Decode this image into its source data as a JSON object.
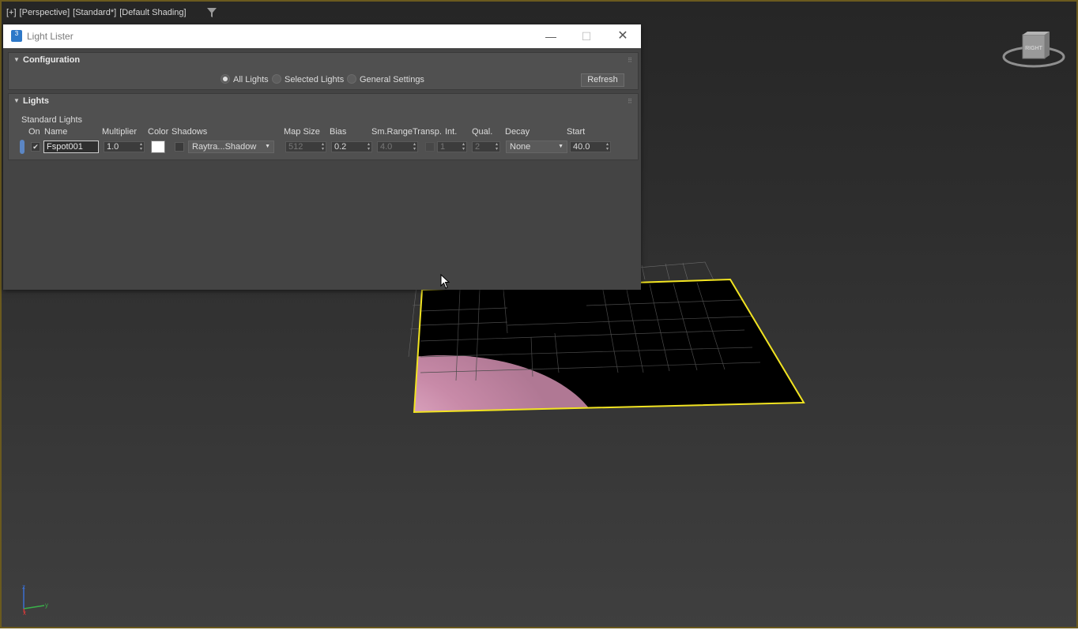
{
  "viewport": {
    "label_parts": [
      "[+]",
      "[Perspective]",
      "[Standard*]",
      "[Default Shading]"
    ],
    "viewcube_face": "RIGHT",
    "axis": {
      "x": "x",
      "y": "y",
      "z": "z"
    },
    "colors": {
      "selection": "#f2e421",
      "light_pool": "#e7a9c9",
      "frame": "#6b5a1e"
    }
  },
  "window": {
    "title": "Light Lister",
    "app_icon_text": "3",
    "controls": {
      "minimize": "—",
      "maximize": "☐",
      "close": "✕"
    }
  },
  "configuration": {
    "title": "Configuration",
    "options": [
      "All Lights",
      "Selected Lights",
      "General Settings"
    ],
    "selected_option": "All Lights",
    "refresh_label": "Refresh"
  },
  "lights": {
    "title": "Lights",
    "group_label": "Standard Lights",
    "headers": {
      "on": "On",
      "name": "Name",
      "multiplier": "Multiplier",
      "color": "Color",
      "shadows": "Shadows",
      "map_size": "Map Size",
      "bias": "Bias",
      "sm_range": "Sm.Range",
      "transp": "Transp.",
      "int": "Int.",
      "qual": "Qual.",
      "decay": "Decay",
      "start": "Start"
    },
    "row": {
      "on": true,
      "name": "Fspot001",
      "multiplier": "1.0",
      "color": "#ffffff",
      "shadows_on": false,
      "shadow_type": "Raytra...Shadow",
      "map_size": "512",
      "bias": "0.2",
      "sm_range": "4.0",
      "transp": false,
      "int": "1",
      "qual": "2",
      "decay": "None",
      "start": "40.0"
    }
  }
}
